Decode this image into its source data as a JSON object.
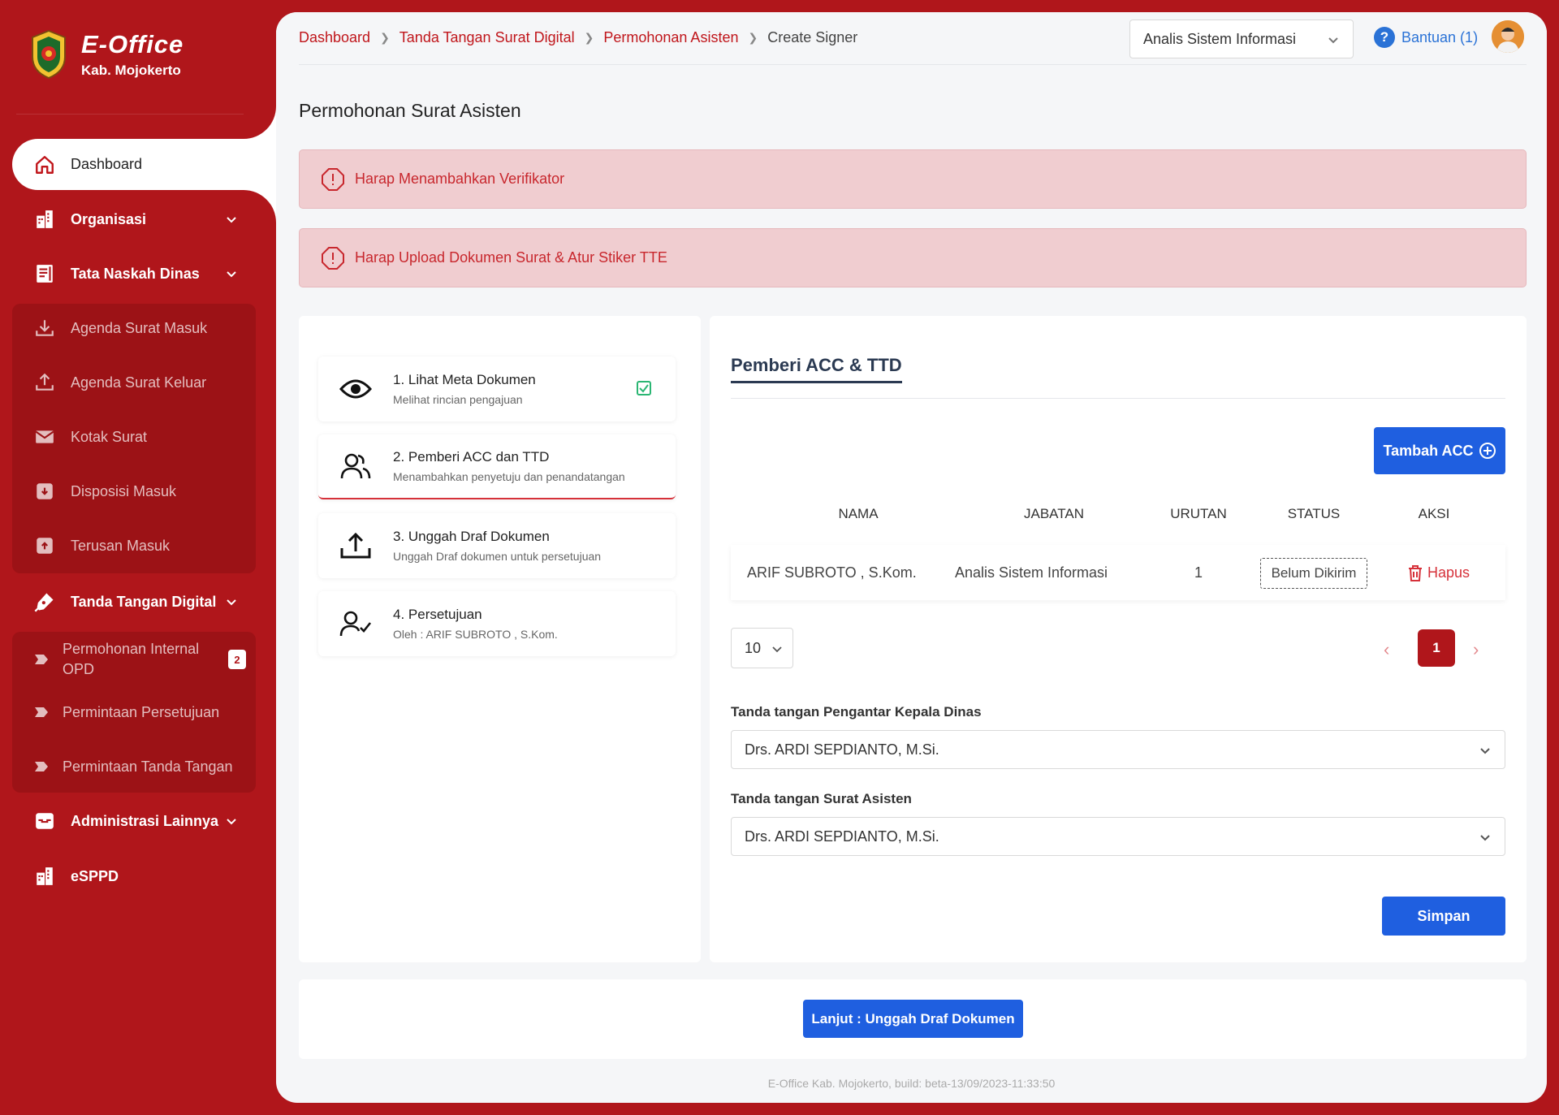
{
  "brand": {
    "title": "E-Office",
    "subtitle": "Kab. Mojokerto"
  },
  "sidebar": {
    "dashboard": "Dashboard",
    "organisasi": "Organisasi",
    "tata_naskah": "Tata Naskah Dinas",
    "tata_items": [
      "Agenda Surat Masuk",
      "Agenda Surat Keluar",
      "Kotak Surat",
      "Disposisi Masuk",
      "Terusan Masuk"
    ],
    "ttd_digital": "Tanda Tangan Digital",
    "ttd_items": [
      "Permohonan Internal OPD",
      "Permintaan Persetujuan",
      "Permintaan Tanda Tangan"
    ],
    "ttd_badge": "2",
    "administrasi": "Administrasi Lainnya",
    "esppd": "eSPPD"
  },
  "breadcrumb": {
    "items": [
      "Dashboard",
      "Tanda Tangan Surat Digital",
      "Permohonan Asisten"
    ],
    "current": "Create Signer"
  },
  "header": {
    "role": "Analis Sistem Informasi",
    "help": "Bantuan (1)"
  },
  "page": {
    "title": "Permohonan Surat Asisten",
    "alerts": [
      "Harap Menambahkan Verifikator",
      "Harap Upload Dokumen Surat & Atur Stiker TTE"
    ]
  },
  "steps": [
    {
      "title": "1. Lihat Meta Dokumen",
      "desc": "Melihat rincian pengajuan"
    },
    {
      "title": "2. Pemberi ACC dan TTD",
      "desc": "Menambahkan penyetuju dan penandatangan"
    },
    {
      "title": "3. Unggah Draf Dokumen",
      "desc": "Unggah Draf dokumen untuk persetujuan"
    },
    {
      "title": "4. Persetujuan",
      "desc": "Oleh : ARIF SUBROTO , S.Kom."
    }
  ],
  "panel": {
    "tab": "Pemberi ACC & TTD",
    "add_button": "Tambah ACC",
    "columns": [
      "NAMA",
      "JABATAN",
      "URUTAN",
      "STATUS",
      "AKSI"
    ],
    "rows": [
      {
        "nama": "ARIF SUBROTO , S.Kom.",
        "jabatan": "Analis Sistem Informasi",
        "urutan": "1",
        "status": "Belum Dikirim",
        "aksi": "Hapus"
      }
    ],
    "page_size": "10",
    "page": "1",
    "field1_label": "Tanda tangan Pengantar Kepala Dinas",
    "field1_value": "Drs. ARDI SEPDIANTO, M.Si.",
    "field2_label": "Tanda tangan Surat Asisten",
    "field2_value": "Drs. ARDI SEPDIANTO, M.Si.",
    "save_button": "Simpan"
  },
  "next_button": "Lanjut : Unggah Draf Dokumen",
  "footer": "E-Office Kab. Mojokerto, build: beta-13/09/2023-11:33:50",
  "colors": {
    "brand_red": "#b0161b",
    "primary_blue": "#1f5fe0",
    "alert_bg": "#f0cdd0"
  }
}
